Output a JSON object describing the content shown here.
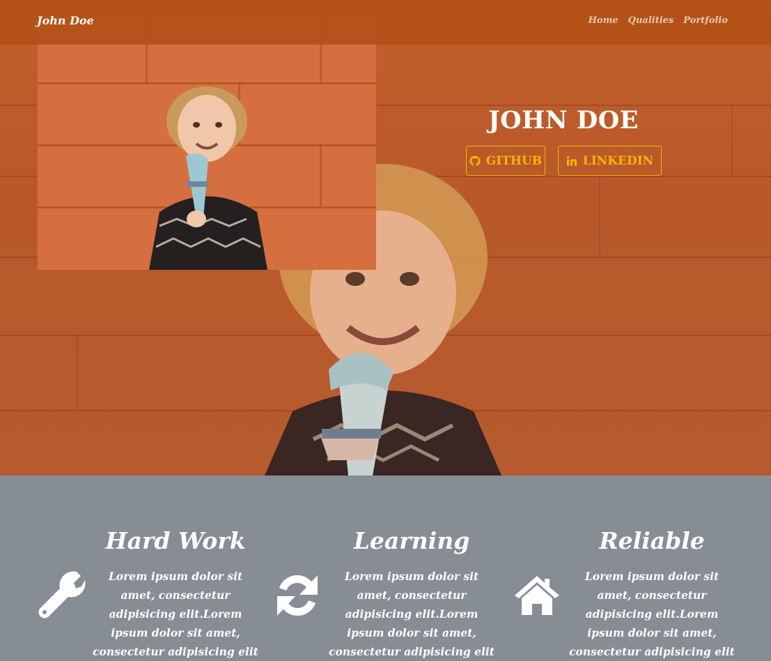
{
  "navbar": {
    "brand": "John Doe",
    "links": [
      "Home",
      "Qualities",
      "Portfolio"
    ]
  },
  "hero": {
    "title": "JOHN DOE",
    "buttons": [
      {
        "label": "GITHUB",
        "icon": "github-icon"
      },
      {
        "label": "LINKEDIN",
        "icon": "linkedin-icon"
      }
    ]
  },
  "qualities": [
    {
      "title": "Hard Work",
      "icon": "wrench-icon",
      "text": "Lorem ipsum dolor sit amet, consectetur adipisicing elit.Lorem ipsum dolor sit amet, consectetur adipisicing elit"
    },
    {
      "title": "Learning",
      "icon": "refresh-icon",
      "text": "Lorem ipsum dolor sit amet, consectetur adipisicing elit.Lorem ipsum dolor sit amet, consectetur adipisicing elit"
    },
    {
      "title": "Reliable",
      "icon": "home-icon",
      "text": "Lorem ipsum dolor sit amet, consectetur adipisicing elit.Lorem ipsum dolor sit amet, consectetur adipisicing elit"
    }
  ],
  "colors": {
    "accent": "#f5b700",
    "navbar": "#b25014",
    "hero_bg": "#c1602b",
    "qualities_bg": "#868d94"
  }
}
